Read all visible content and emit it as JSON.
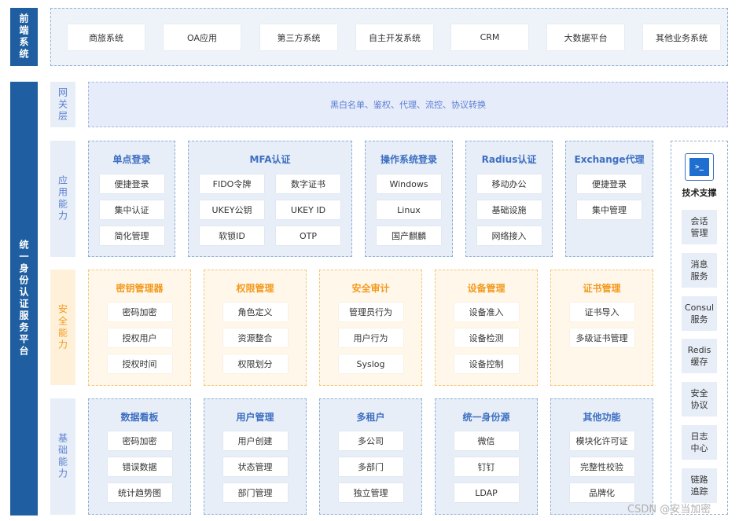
{
  "front": {
    "label": "前端系统",
    "systems": [
      "商旅系统",
      "OA应用",
      "第三方系统",
      "自主开发系统",
      "CRM",
      "大数据平台",
      "其他业务系统"
    ]
  },
  "platform_label": "统一身份认证服务平台",
  "gateway": {
    "label": "网关层",
    "text": "黑白名单、鉴权、代理、流控、协议转换"
  },
  "app": {
    "label": "应用能力",
    "sso": {
      "title": "单点登录",
      "items": [
        "便捷登录",
        "集中认证",
        "简化管理"
      ]
    },
    "mfa": {
      "title": "MFA认证",
      "items": [
        "FIDO令牌",
        "数字证书",
        "UKEY公钥",
        "UKEY ID",
        "软锁ID",
        "OTP"
      ]
    },
    "os": {
      "title": "操作系统登录",
      "items": [
        "Windows",
        "Linux",
        "国产麒麟"
      ]
    },
    "radius": {
      "title": "Radius认证",
      "items": [
        "移动办公",
        "基础设施",
        "网络接入"
      ]
    },
    "exchange": {
      "title": "Exchange代理",
      "items": [
        "便捷登录",
        "集中管理"
      ]
    }
  },
  "security": {
    "label": "安全能力",
    "cards": [
      {
        "title": "密钥管理器",
        "items": [
          "密码加密",
          "授权用户",
          "授权时间"
        ]
      },
      {
        "title": "权限管理",
        "items": [
          "角色定义",
          "资源整合",
          "权限划分"
        ]
      },
      {
        "title": "安全审计",
        "items": [
          "管理员行为",
          "用户行为",
          "Syslog"
        ]
      },
      {
        "title": "设备管理",
        "items": [
          "设备准入",
          "设备检测",
          "设备控制"
        ]
      },
      {
        "title": "证书管理",
        "items": [
          "证书导入",
          "多级证书管理"
        ]
      }
    ]
  },
  "basic": {
    "label": "基础能力",
    "cards": [
      {
        "title": "数据看板",
        "items": [
          "密码加密",
          "错误数据",
          "统计趋势图"
        ]
      },
      {
        "title": "用户管理",
        "items": [
          "用户创建",
          "状态管理",
          "部门管理"
        ]
      },
      {
        "title": "多租户",
        "items": [
          "多公司",
          "多部门",
          "独立管理"
        ]
      },
      {
        "title": "统一身份源",
        "items": [
          "微信",
          "钉钉",
          "LDAP"
        ]
      },
      {
        "title": "其他功能",
        "items": [
          "模块化许可证",
          "完整性校验",
          "品牌化"
        ]
      }
    ]
  },
  "tech": {
    "icon": "terminal-icon",
    "icon_glyph": ">_",
    "title": "技术支撑",
    "items": [
      [
        "会话",
        "管理"
      ],
      [
        "消息",
        "服务"
      ],
      [
        "Consul",
        "服务"
      ],
      [
        "Redis",
        "缓存"
      ],
      [
        "安全",
        "协议"
      ],
      [
        "日志",
        "中心"
      ],
      [
        "链路",
        "追踪"
      ]
    ]
  },
  "watermark": "CSDN @安当加密",
  "colors": {
    "dark_blue": "#1f5fa1",
    "title_blue": "#3d6fc2",
    "orange": "#f39a1f",
    "light_blue_bg": "#e7eef7",
    "orange_bg": "#fff7ea"
  }
}
